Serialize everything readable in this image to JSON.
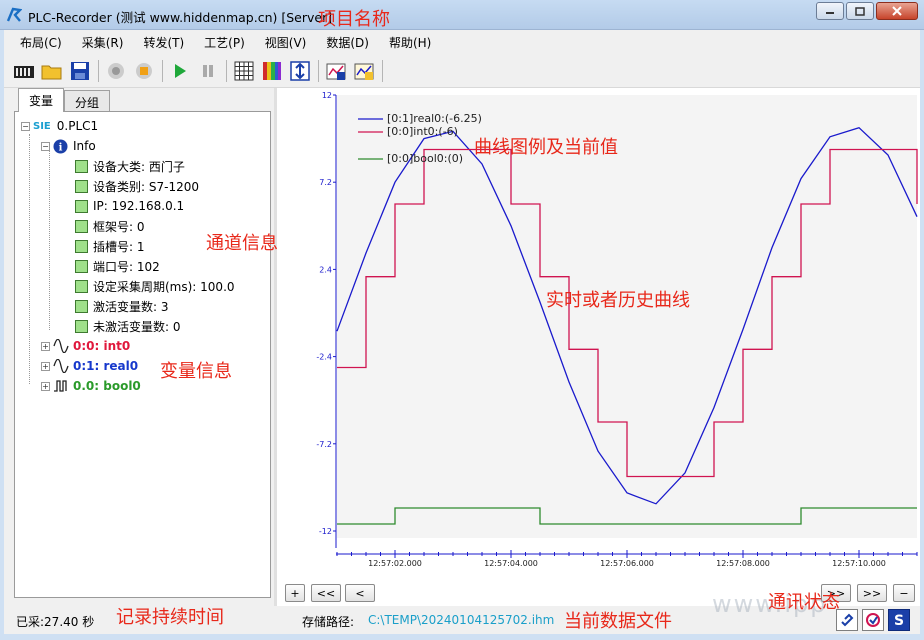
{
  "window": {
    "title": "PLC-Recorder (测试 www.hiddenmap.cn) [Server]"
  },
  "menu": [
    "布局(C)",
    "采集(R)",
    "转发(T)",
    "工艺(P)",
    "视图(V)",
    "数据(D)",
    "帮助(H)"
  ],
  "toolbar": {
    "icons": [
      "plc-device-icon",
      "open-folder-icon",
      "save-icon",
      "record-icon",
      "stop-icon",
      "play-icon",
      "pause-icon",
      "grid-icon",
      "color-palette-icon",
      "scale-vertical-icon",
      "export-chart-icon",
      "import-chart-icon"
    ]
  },
  "tabs": [
    {
      "label": "变量",
      "active": true
    },
    {
      "label": "分组",
      "active": false
    }
  ],
  "tree": {
    "root_tag": "SIE",
    "root": "0.PLC1",
    "info_label": "Info",
    "info_items": [
      "设备大类: 西门子",
      "设备类别: S7-1200",
      "IP: 192.168.0.1",
      "框架号: 0",
      "插槽号: 1",
      "端口号: 102",
      "设定采集周期(ms): 100.0",
      "激活变量数: 3",
      "未激活变量数: 0"
    ],
    "variables": [
      {
        "label": "0:0: int0",
        "color": "#e0183c"
      },
      {
        "label": "0:1: real0",
        "color": "#1638cc"
      },
      {
        "label": "0.0: bool0",
        "color": "#2a9a2a"
      }
    ]
  },
  "chart": {
    "legend": [
      {
        "label": "[0:1]real0:(-6.25)",
        "color": "#1a1acc"
      },
      {
        "label": "[0:0]int0:(-6)",
        "color": "#d01450"
      },
      {
        "label": "[0:0]bool0:(0)",
        "color": "#2e8b2e"
      }
    ],
    "y_ticks": [
      "12",
      "7.2",
      "2.4",
      "-2.4",
      "-7.2",
      "-12"
    ],
    "x_ticks": [
      "12:57:02.000",
      "12:57:04.000",
      "12:57:06.000",
      "12:57:08.000",
      "12:57:10.000"
    ],
    "nav_left": [
      "+",
      "<<",
      "<"
    ],
    "nav_right": [
      ">>",
      ">>",
      "−"
    ]
  },
  "chart_data": {
    "type": "line",
    "ylim": [
      -12,
      12
    ],
    "x_range": [
      "12:57:01.000",
      "12:57:11.000"
    ],
    "series": [
      {
        "name": "[0:1]real0:(-6.25)",
        "x": [
          0,
          0.5,
          1,
          1.5,
          2,
          2.5,
          3,
          3.5,
          4,
          4.5,
          5,
          5.5,
          6,
          6.5,
          7,
          7.5,
          8,
          8.5,
          9,
          9.5,
          10
        ],
        "values": [
          -1.0,
          3.3,
          7.2,
          9.6,
          10.0,
          8.2,
          4.8,
          0.6,
          -3.8,
          -7.6,
          -9.9,
          -10.5,
          -8.8,
          -5.2,
          -0.9,
          3.6,
          7.4,
          9.7,
          10.2,
          8.7,
          5.3
        ]
      },
      {
        "name": "[0:0]int0:(-6)",
        "x": [
          0,
          0.5,
          1,
          1.5,
          2,
          2.5,
          3,
          3.5,
          4,
          4.5,
          5,
          5.5,
          6,
          6.5,
          7,
          7.5,
          8,
          8.5,
          9,
          9.5,
          10
        ],
        "values": [
          -3,
          2,
          6,
          9,
          9,
          9,
          6,
          2,
          -2,
          -6,
          -9,
          -9,
          -9,
          -6,
          -2,
          2,
          6,
          9,
          9,
          9,
          6
        ]
      },
      {
        "name": "[0:0]bool0:(0)",
        "x": [
          0,
          0.5,
          1,
          1.5,
          2,
          2.5,
          3,
          3.5,
          4,
          4.5,
          5,
          5.5,
          6,
          6.5,
          7,
          7.5,
          8,
          8.5,
          9,
          9.5,
          10
        ],
        "values": [
          0,
          0,
          1,
          1,
          1,
          1,
          1,
          0,
          0,
          0,
          0,
          0,
          0,
          0,
          0,
          0,
          1,
          1,
          1,
          1,
          1
        ]
      }
    ]
  },
  "status": {
    "elapsed": "已采:27.40 秒",
    "path_label": "存储路径:",
    "path_value": "C:\\TEMP\\20240104125702.ihm",
    "status_icons": [
      "link-icon",
      "connection-status-icon",
      "server-s-icon"
    ]
  },
  "annotations": {
    "project_name": "项目名称",
    "legend_note": "曲线图例及当前值",
    "channel_info": "通道信息",
    "realtime_curve": "实时或者历史曲线",
    "variable_info": "变量信息",
    "record_duration": "记录持续时间",
    "data_file": "当前数据文件",
    "comm_status": "通讯状态"
  },
  "watermark": "www.ipp"
}
